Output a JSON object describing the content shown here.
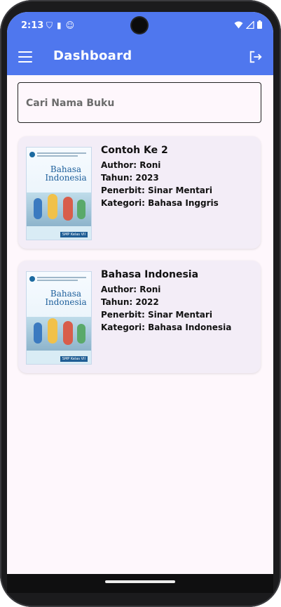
{
  "status": {
    "time": "2:13"
  },
  "appbar": {
    "title": "Dashboard"
  },
  "search": {
    "placeholder": "Cari Nama Buku"
  },
  "books": [
    {
      "title": "Contoh Ke 2",
      "author": "Author: Roni",
      "year": "Tahun: 2023",
      "publisher": "Penerbit: Sinar Mentari",
      "category": "Kategori: Bahasa Inggris",
      "cover_title": "Bahasa Indonesia",
      "cover_badge": "SMP Kelas VII"
    },
    {
      "title": "Bahasa Indonesia",
      "author": "Author: Roni",
      "year": "Tahun: 2022",
      "publisher": "Penerbit: Sinar Mentari",
      "category": "Kategori: Bahasa Indonesia",
      "cover_title": "Bahasa Indonesia",
      "cover_badge": "SMP Kelas VII"
    }
  ],
  "colors": {
    "primary": "#4f77ee",
    "background": "#fef7fc",
    "card": "#f3edf7"
  },
  "icons": {
    "menu": "menu-icon",
    "logout": "logout-icon"
  }
}
